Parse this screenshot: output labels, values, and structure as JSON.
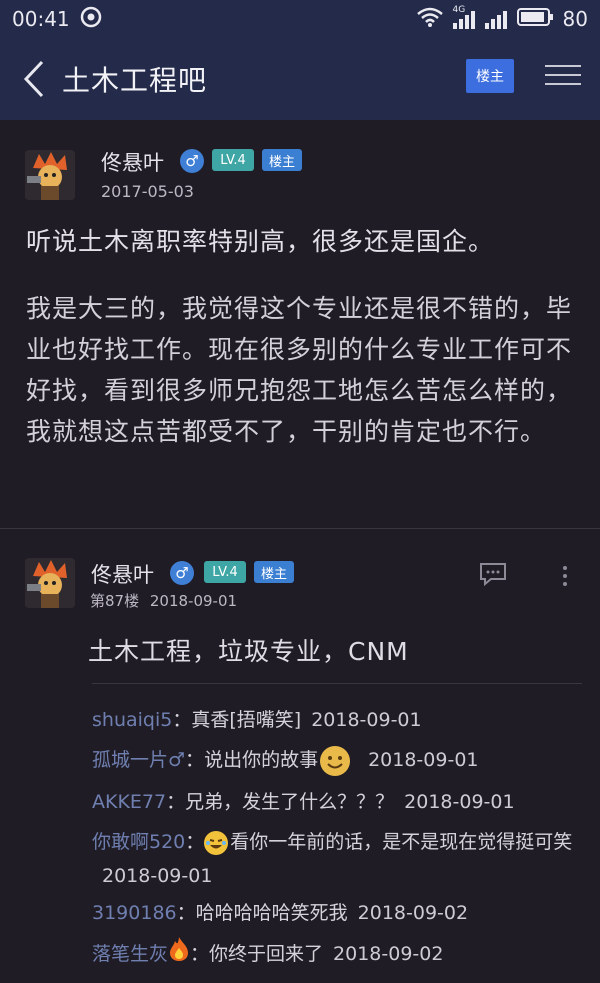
{
  "status_bar": {
    "time": "00:41",
    "signal_label": "4G",
    "battery": "80"
  },
  "nav": {
    "title": "土木工程吧",
    "louzhu_toggle": "楼主"
  },
  "post": {
    "author": "佟悬叶",
    "level": "LV.4",
    "role_badge": "楼主",
    "date": "2017-05-03",
    "title": "听说土木离职率特别高，很多还是国企。",
    "body": "我是大三的，我觉得这个专业还是很不错的，毕业也好找工作。现在很多别的什么专业工作可不好找，看到很多师兄抱怨工地怎么苦怎么样的，我就想这点苦都受不了，干别的肯定也不行。"
  },
  "reply": {
    "author": "佟悬叶",
    "level": "LV.4",
    "role_badge": "楼主",
    "floor": "第87楼",
    "date": "2018-09-01",
    "text": "土木工程，垃圾专业，CNM",
    "comments": [
      {
        "user": "shuaiqi5",
        "text": "真香[捂嘴笑]",
        "date": "2018-09-01"
      },
      {
        "user": "孤城一片♂",
        "text": "说出你的故事",
        "date": "2018-09-01"
      },
      {
        "user": "AKKE77",
        "text": "兄弟，发生了什么？？？",
        "date": "2018-09-01"
      },
      {
        "user": "你敢啊520",
        "text": "看你一年前的话，是不是现在觉得挺可笑",
        "date": "2018-09-01"
      },
      {
        "user": "3190186",
        "text": "哈哈哈哈哈笑死我",
        "date": "2018-09-02"
      },
      {
        "user": "落笔生灰",
        "text": "你终于回来了",
        "date": "2018-09-02"
      }
    ]
  },
  "colors": {
    "nav_bg": "#232a4a",
    "page_bg": "#1f1c25",
    "accent_blue": "#3c6ee0",
    "level_teal": "#3fa6a6",
    "comment_user": "#6f7fb0"
  },
  "icons": [
    "back-arrow-icon",
    "menu-icon",
    "male-gender-icon",
    "comment-icon",
    "more-vertical-icon",
    "wifi-icon",
    "signal-icon",
    "battery-icon",
    "smile-emoji-icon",
    "laugh-cry-emoji-icon",
    "fire-emoji-icon"
  ]
}
